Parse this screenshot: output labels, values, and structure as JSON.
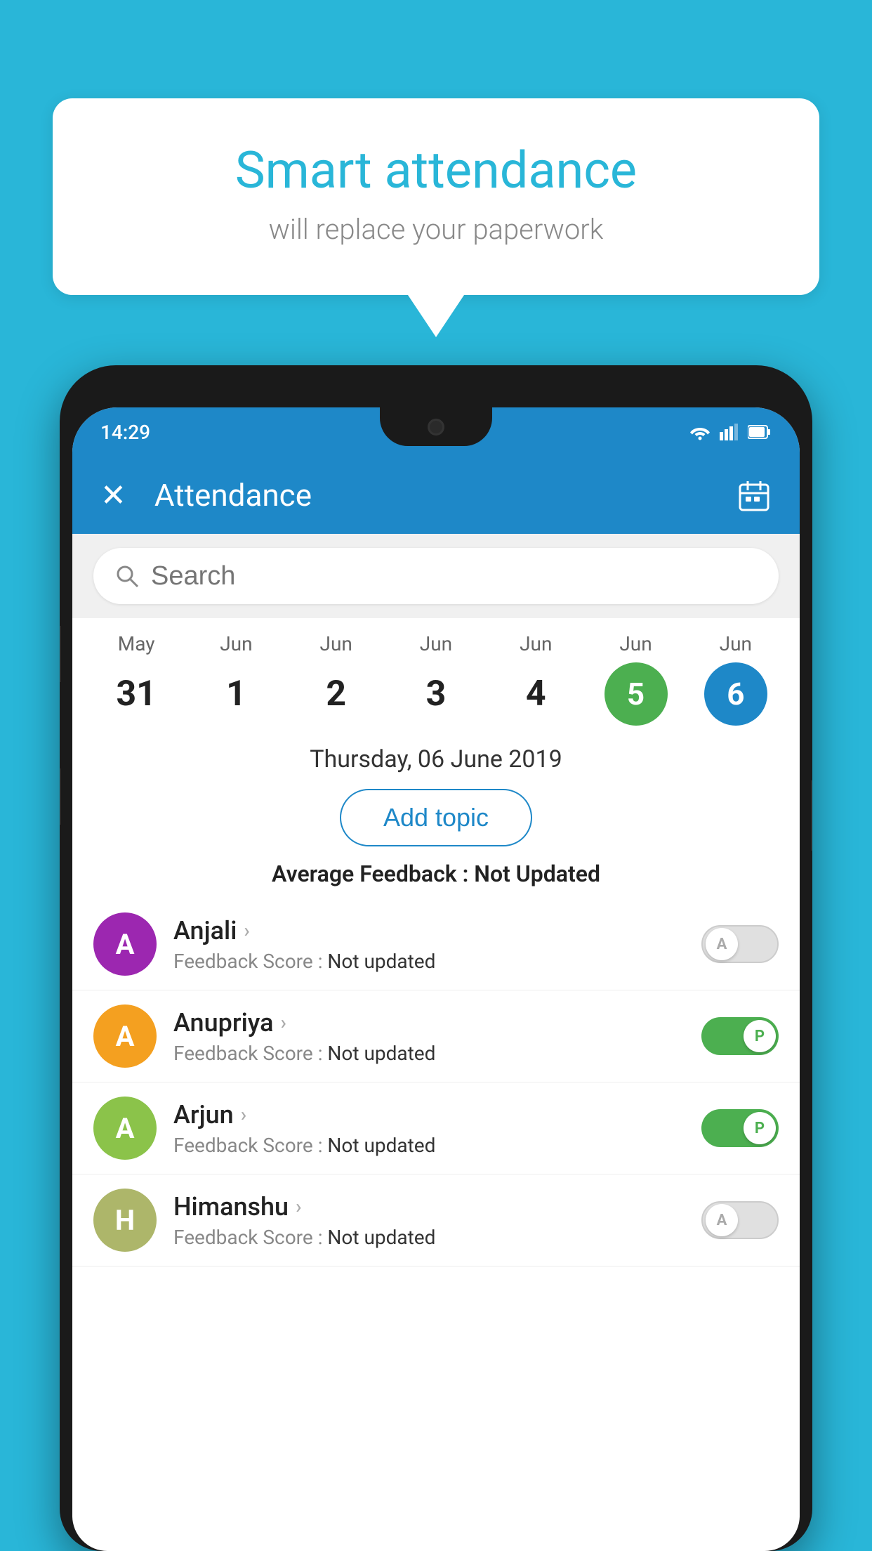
{
  "background_color": "#29b6d8",
  "bubble": {
    "title": "Smart attendance",
    "subtitle": "will replace your paperwork"
  },
  "status_bar": {
    "time": "14:29",
    "icons": [
      "wifi",
      "signal",
      "battery"
    ]
  },
  "app_bar": {
    "close_label": "✕",
    "title": "Attendance",
    "calendar_icon": "📅"
  },
  "search": {
    "placeholder": "Search"
  },
  "calendar": {
    "days": [
      {
        "month": "May",
        "date": "31",
        "state": "normal"
      },
      {
        "month": "Jun",
        "date": "1",
        "state": "normal"
      },
      {
        "month": "Jun",
        "date": "2",
        "state": "normal"
      },
      {
        "month": "Jun",
        "date": "3",
        "state": "normal"
      },
      {
        "month": "Jun",
        "date": "4",
        "state": "normal"
      },
      {
        "month": "Jun",
        "date": "5",
        "state": "today"
      },
      {
        "month": "Jun",
        "date": "6",
        "state": "selected"
      }
    ]
  },
  "selected_date": "Thursday, 06 June 2019",
  "add_topic_label": "Add topic",
  "avg_feedback_label": "Average Feedback :",
  "avg_feedback_value": "Not Updated",
  "students": [
    {
      "name": "Anjali",
      "avatar_letter": "A",
      "avatar_color": "#9c27b0",
      "feedback_label": "Feedback Score :",
      "feedback_value": "Not updated",
      "toggle": "off",
      "toggle_letter": "A"
    },
    {
      "name": "Anupriya",
      "avatar_letter": "A",
      "avatar_color": "#f4a020",
      "feedback_label": "Feedback Score :",
      "feedback_value": "Not updated",
      "toggle": "on",
      "toggle_letter": "P"
    },
    {
      "name": "Arjun",
      "avatar_letter": "A",
      "avatar_color": "#8bc34a",
      "feedback_label": "Feedback Score :",
      "feedback_value": "Not updated",
      "toggle": "on",
      "toggle_letter": "P"
    },
    {
      "name": "Himanshu",
      "avatar_letter": "H",
      "avatar_color": "#adb66a",
      "feedback_label": "Feedback Score :",
      "feedback_value": "Not updated",
      "toggle": "off",
      "toggle_letter": "A"
    }
  ]
}
